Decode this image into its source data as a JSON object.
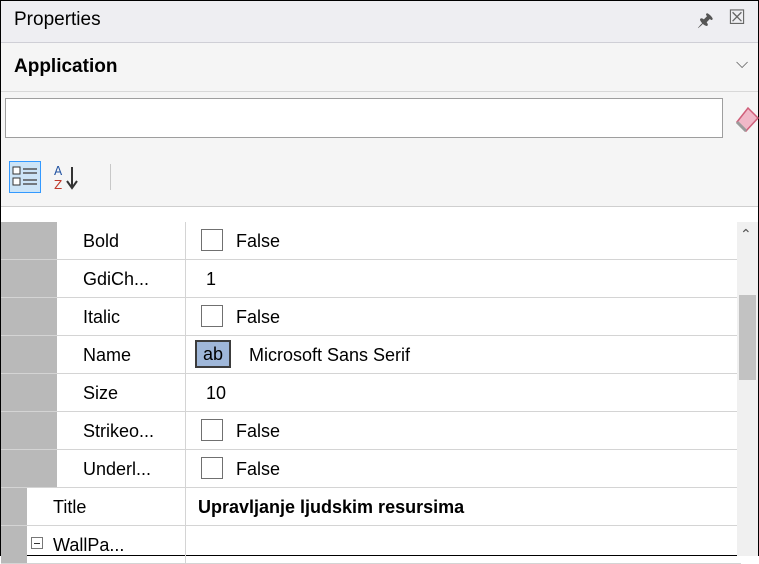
{
  "window": {
    "title": "Properties"
  },
  "object_selector": {
    "value": "Application"
  },
  "search": {
    "value": "",
    "placeholder": ""
  },
  "toolbar": {
    "categorized_icon": "categorized-icon",
    "alphabetical_icon": "sort-alphabetical-icon"
  },
  "properties": [
    {
      "name": "Bold",
      "value": "False",
      "type": "checkbox",
      "level": "sub"
    },
    {
      "name": "GdiCh...",
      "value": "1",
      "type": "text",
      "level": "sub"
    },
    {
      "name": "Italic",
      "value": "False",
      "type": "checkbox",
      "level": "sub"
    },
    {
      "name": "Name",
      "value": "Microsoft Sans Serif",
      "type": "font",
      "badge": "ab",
      "level": "sub"
    },
    {
      "name": "Size",
      "value": "10",
      "type": "text",
      "level": "sub"
    },
    {
      "name": "Strikeo...",
      "value": "False",
      "type": "checkbox",
      "level": "sub"
    },
    {
      "name": "Underl...",
      "value": "False",
      "type": "checkbox",
      "level": "sub"
    },
    {
      "name": "Title",
      "value": "Upravljanje ljudskim resursima",
      "type": "bold",
      "level": "top"
    },
    {
      "name": "WallPa...",
      "value": "",
      "type": "expand",
      "level": "top"
    }
  ],
  "colors": {
    "gutter": "#b9b9b9",
    "selection": "#cce4f7",
    "accent": "#3399ff"
  }
}
